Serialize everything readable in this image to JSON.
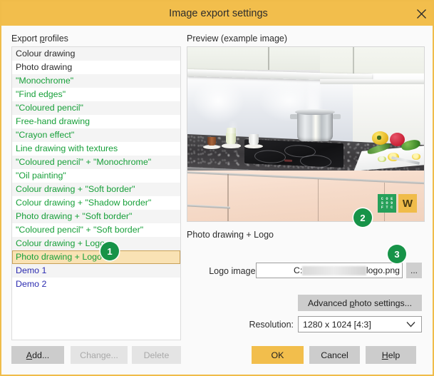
{
  "window": {
    "title": "Image export settings",
    "close_icon": "close-icon"
  },
  "left_panel": {
    "label": "Export profiles",
    "label_accel": "p",
    "items": [
      {
        "label": "Colour drawing",
        "color": "dark",
        "selected": false
      },
      {
        "label": "Photo drawing",
        "color": "dark",
        "selected": false
      },
      {
        "label": "\"Monochrome\"",
        "color": "green",
        "selected": false
      },
      {
        "label": "\"Find edges\"",
        "color": "green",
        "selected": false
      },
      {
        "label": "\"Coloured pencil\"",
        "color": "green",
        "selected": false
      },
      {
        "label": "Free-hand drawing",
        "color": "green",
        "selected": false
      },
      {
        "label": "\"Crayon effect\"",
        "color": "green",
        "selected": false
      },
      {
        "label": "Line drawing with textures",
        "color": "green",
        "selected": false
      },
      {
        "label": "\"Coloured pencil\" + \"Monochrome\"",
        "color": "green",
        "selected": false
      },
      {
        "label": "\"Oil painting\"",
        "color": "green",
        "selected": false
      },
      {
        "label": "Colour drawing + \"Soft border\"",
        "color": "green",
        "selected": false
      },
      {
        "label": "Colour drawing + \"Shadow border\"",
        "color": "green",
        "selected": false
      },
      {
        "label": "Photo drawing  + \"Soft border\"",
        "color": "green",
        "selected": false
      },
      {
        "label": "\"Coloured pencil\" + \"Soft border\"",
        "color": "green",
        "selected": false
      },
      {
        "label": "Colour drawing + Logo",
        "color": "green",
        "selected": false
      },
      {
        "label": "Photo drawing + Logo",
        "color": "green",
        "selected": true
      },
      {
        "label": "Demo 1",
        "color": "blue",
        "selected": false
      },
      {
        "label": "Demo 2",
        "color": "blue",
        "selected": false
      }
    ],
    "buttons": {
      "add": {
        "label": "Add...",
        "accel": "A",
        "enabled": true
      },
      "change": {
        "label": "Change...",
        "accel": "g",
        "enabled": false
      },
      "delete": {
        "label": "Delete",
        "accel": "",
        "enabled": false
      }
    }
  },
  "preview": {
    "label": "Preview (example image)",
    "caption": "Photo drawing + Logo",
    "watermark": {
      "green_tile_rows": [
        "COE",
        "SO9",
        "FTC"
      ],
      "amber_tile_letter": "W"
    }
  },
  "form": {
    "logo_image": {
      "label": "Logo image:",
      "label_accel": "g",
      "path_start": "C:",
      "path_end": "logo.png",
      "browse_label": "..."
    },
    "advanced": {
      "label": "Advanced photo settings...",
      "accel": "p"
    },
    "resolution": {
      "label": "Resolution:",
      "value": "1280 x 1024 [4:3]",
      "options": [
        "1280 x 1024 [4:3]"
      ]
    }
  },
  "dialog_buttons": {
    "ok": {
      "label": "OK",
      "primary": true
    },
    "cancel": {
      "label": "Cancel",
      "primary": false
    },
    "help": {
      "label": "Help",
      "accel": "H",
      "primary": false
    }
  },
  "callouts": [
    {
      "number": "1"
    },
    {
      "number": "2"
    },
    {
      "number": "3"
    }
  ],
  "colors": {
    "titlebar": "#f2be4c",
    "accent": "#f0bc4a",
    "badge_green": "#179348",
    "item_green": "#18a03a",
    "item_blue": "#2b2bb0",
    "selection_bg": "#f9e2b4",
    "selection_border": "#c8a158"
  }
}
